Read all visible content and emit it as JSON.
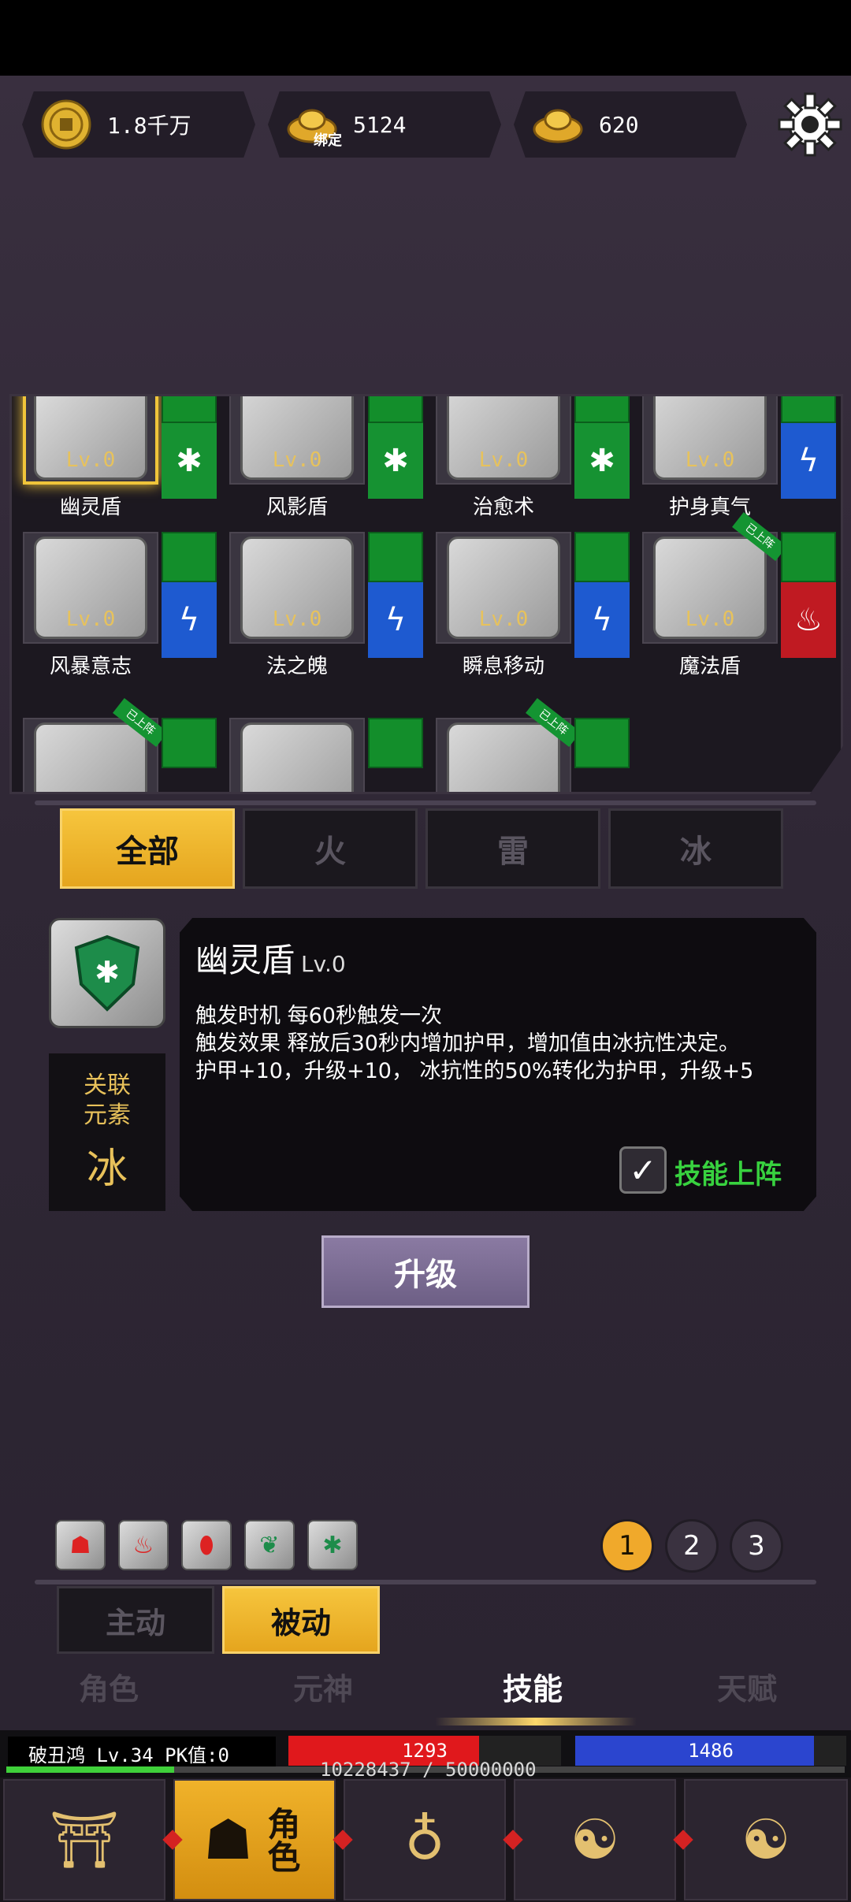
{
  "currency": {
    "coins": "1.8千万",
    "bound_ingot_label": "绑定",
    "bound_ingot": "5124",
    "ingot": "620"
  },
  "skills": [
    {
      "name": "幽灵盾",
      "lv": "Lv.0",
      "element": "ice",
      "element_icon": "✱",
      "selected": true
    },
    {
      "name": "风影盾",
      "lv": "Lv.0",
      "element": "ice",
      "element_icon": "✱"
    },
    {
      "name": "治愈术",
      "lv": "Lv.0",
      "element": "ice",
      "element_icon": "✱"
    },
    {
      "name": "护身真气",
      "lv": "Lv.0",
      "element": "thunder",
      "element_icon": "ϟ"
    },
    {
      "name": "风暴意志",
      "lv": "Lv.0",
      "element": "thunder",
      "element_icon": "ϟ"
    },
    {
      "name": "法之魄",
      "lv": "Lv.0",
      "element": "thunder",
      "element_icon": "ϟ"
    },
    {
      "name": "瞬息移动",
      "lv": "Lv.0",
      "element": "thunder",
      "element_icon": "ϟ"
    },
    {
      "name": "魔法盾",
      "lv": "Lv.0",
      "element": "fire",
      "element_icon": "♨",
      "deployed": true
    }
  ],
  "deployed_label": "已上阵",
  "element_tabs": [
    "全部",
    "火",
    "雷",
    "冰"
  ],
  "detail": {
    "title": "幽灵盾",
    "level": "Lv.0",
    "trigger_time_label": "触发时机",
    "trigger_time": "每60秒触发一次",
    "trigger_effect_label": "触发效果",
    "trigger_effect": "释放后30秒内增加护甲，增加值由冰抗性决定。",
    "detail_line": "护甲+10，升级+10， 冰抗性的50%转化为护甲，升级+5",
    "related_label_1": "关联",
    "related_label_2": "元素",
    "related_element": "冰",
    "deploy_checkbox_label": "技能上阵"
  },
  "upgrade_label": "升级",
  "equipped_icons": [
    "☗",
    "♨",
    "⬮",
    "❦",
    "✱"
  ],
  "pages": [
    "1",
    "2",
    "3"
  ],
  "modes": [
    "主动",
    "被动"
  ],
  "main_tabs": [
    "角色",
    "元神",
    "技能",
    "天赋"
  ],
  "status": {
    "player": "破丑鸿  Lv.34 PK值:0",
    "hp": "1293",
    "hp_ratio": 0.7,
    "mp": "1486",
    "mp_ratio": 0.88,
    "exp_text": "10228437 / 50000000",
    "exp_ratio": 0.2
  },
  "bottom_nav": [
    {
      "icon": "town-icon",
      "glyph": "⛩"
    },
    {
      "icon": "character-icon",
      "glyph": "☗",
      "label": "角色"
    },
    {
      "icon": "bag-icon",
      "glyph": "♁"
    },
    {
      "icon": "meditation-icon",
      "glyph": "☯"
    },
    {
      "icon": "taichi-icon",
      "glyph": "☯"
    }
  ]
}
